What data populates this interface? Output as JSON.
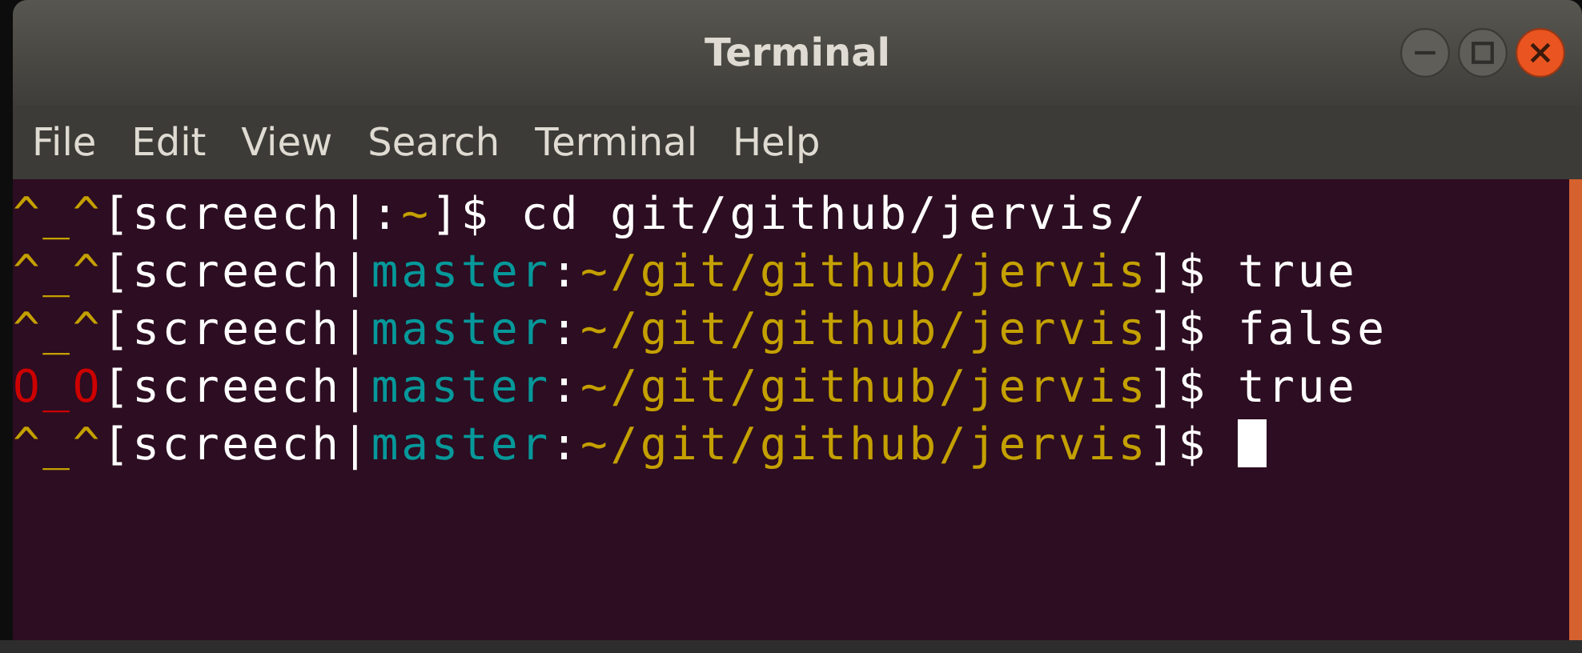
{
  "window": {
    "title": "Terminal"
  },
  "menu": [
    "File",
    "Edit",
    "View",
    "Search",
    "Terminal",
    "Help"
  ],
  "terminal": {
    "lines": [
      {
        "cursor": false,
        "segments": [
          {
            "kind": "face",
            "error": false,
            "text": "^_^"
          },
          {
            "kind": "plain",
            "text": "[screech|:"
          },
          {
            "kind": "path",
            "text": "~"
          },
          {
            "kind": "plain",
            "text": "]$ cd git/github/jervis/"
          }
        ]
      },
      {
        "cursor": false,
        "segments": [
          {
            "kind": "face",
            "error": false,
            "text": "^_^"
          },
          {
            "kind": "plain",
            "text": "[screech|"
          },
          {
            "kind": "branch",
            "text": "master"
          },
          {
            "kind": "plain",
            "text": ":"
          },
          {
            "kind": "path",
            "text": "~/git/github/jervis"
          },
          {
            "kind": "plain",
            "text": "]$ true"
          }
        ]
      },
      {
        "cursor": false,
        "segments": [
          {
            "kind": "face",
            "error": false,
            "text": "^_^"
          },
          {
            "kind": "plain",
            "text": "[screech|"
          },
          {
            "kind": "branch",
            "text": "master"
          },
          {
            "kind": "plain",
            "text": ":"
          },
          {
            "kind": "path",
            "text": "~/git/github/jervis"
          },
          {
            "kind": "plain",
            "text": "]$ false"
          }
        ]
      },
      {
        "cursor": false,
        "segments": [
          {
            "kind": "face",
            "error": true,
            "text": "O_O"
          },
          {
            "kind": "plain",
            "text": "[screech|"
          },
          {
            "kind": "branch",
            "text": "master"
          },
          {
            "kind": "plain",
            "text": ":"
          },
          {
            "kind": "path",
            "text": "~/git/github/jervis"
          },
          {
            "kind": "plain",
            "text": "]$ true"
          }
        ]
      },
      {
        "cursor": true,
        "segments": [
          {
            "kind": "face",
            "error": false,
            "text": "^_^"
          },
          {
            "kind": "plain",
            "text": "[screech|"
          },
          {
            "kind": "branch",
            "text": "master"
          },
          {
            "kind": "plain",
            "text": ":"
          },
          {
            "kind": "path",
            "text": "~/git/github/jervis"
          },
          {
            "kind": "plain",
            "text": "]$ "
          }
        ]
      }
    ]
  }
}
